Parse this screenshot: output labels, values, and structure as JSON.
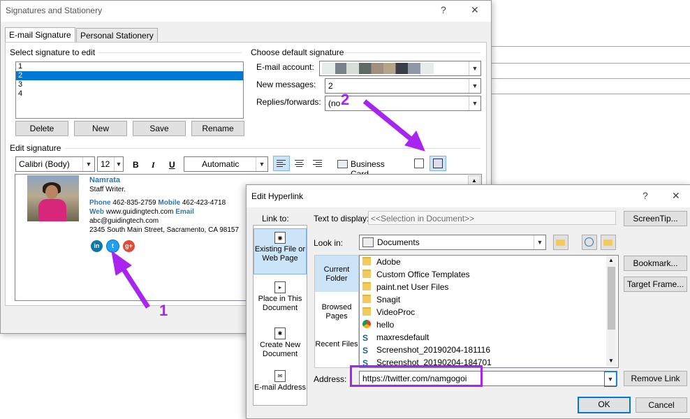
{
  "signatures_dialog": {
    "title": "Signatures and Stationery",
    "help": "?",
    "close": "✕",
    "tabs": [
      "E-mail Signature",
      "Personal Stationery"
    ],
    "select_label": "Select signature to edit",
    "signatures": [
      "1",
      "2",
      "3",
      "4"
    ],
    "selected_index": 1,
    "buttons": {
      "delete": "Delete",
      "new": "New",
      "save": "Save",
      "rename": "Rename"
    },
    "default_label": "Choose default signature",
    "email_account_label": "E-mail account:",
    "new_messages_label": "New messages:",
    "new_messages_value": "2",
    "replies_label": "Replies/forwards:",
    "replies_value": "(no",
    "edit_label": "Edit signature",
    "font": "Calibri (Body)",
    "size": "12",
    "bold": "B",
    "italic": "I",
    "underline": "U",
    "color": "Automatic",
    "business_card": "Business Card"
  },
  "signature_content": {
    "name": "Namrata",
    "role": "Staff Writer.",
    "phone_label": "Phone",
    "phone": "462-835-2759",
    "mobile_label": "Mobile",
    "mobile": "462-423-4718",
    "web_label": "Web",
    "web": "www.guidingtech.com",
    "email_label": "Email",
    "email": "abc@guidingtech.com",
    "address": "2345 South Main Street, Sacramento, CA 98157",
    "social": [
      "in",
      "t",
      "g+"
    ]
  },
  "hyperlink_dialog": {
    "title": "Edit Hyperlink",
    "help": "?",
    "close": "✕",
    "link_to": "Link to:",
    "link_options": [
      "Existing File or Web Page",
      "Place in This Document",
      "Create New Document",
      "E-mail Address"
    ],
    "text_display_label": "Text to display:",
    "text_display_value": "<<Selection in Document>>",
    "screentip": "ScreenTip...",
    "look_in_label": "Look in:",
    "look_in_value": "Documents",
    "side_items": [
      "Current Folder",
      "Browsed Pages",
      "Recent Files"
    ],
    "files": [
      {
        "name": "Adobe",
        "type": "folder"
      },
      {
        "name": "Custom Office Templates",
        "type": "folder"
      },
      {
        "name": "paint.net User Files",
        "type": "folder"
      },
      {
        "name": "Snagit",
        "type": "folder"
      },
      {
        "name": "VideoProc",
        "type": "folder"
      },
      {
        "name": "hello",
        "type": "chrome"
      },
      {
        "name": "maxresdefault",
        "type": "snagit"
      },
      {
        "name": "Screenshot_20190204-181116",
        "type": "snagit"
      },
      {
        "name": "Screenshot_20190204-184701",
        "type": "snagit"
      }
    ],
    "bookmark": "Bookmark...",
    "target_frame": "Target Frame...",
    "address_label": "Address:",
    "address_value": "https://twitter.com/namgogoi",
    "remove_link": "Remove Link",
    "ok": "OK",
    "cancel": "Cancel"
  },
  "annotations": {
    "one": "1",
    "two": "2",
    "color": "#a825f0"
  }
}
